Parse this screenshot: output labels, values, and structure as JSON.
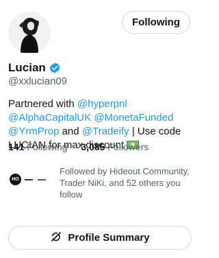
{
  "header": {
    "follow_button_label": "Following"
  },
  "profile": {
    "name": "Lucian",
    "handle": "@xxlucian09",
    "bio": {
      "prefix": "Partnered with ",
      "mention1": "@hyperpnl",
      "mention2": "@AlphaCapitalUK",
      "mention3": "@MonetaFunded",
      "mention4": "@YrmProp",
      "connector": " and ",
      "mention5": "@Tradeify",
      "suffix": " | Use code LUCIAN for max discount "
    }
  },
  "stats": {
    "following_count": "141",
    "following_label": "Following",
    "followers_count": "3,085",
    "followers_label": "Followers"
  },
  "followed_by": {
    "text": "Followed by Hideout Community, Trader NiKi, and 52 others you follow"
  },
  "profile_summary_button": {
    "label": "Profile Summary"
  },
  "colors": {
    "link": "#1d9bf0",
    "verified": "#1d9bf0",
    "text_secondary": "#536471"
  }
}
